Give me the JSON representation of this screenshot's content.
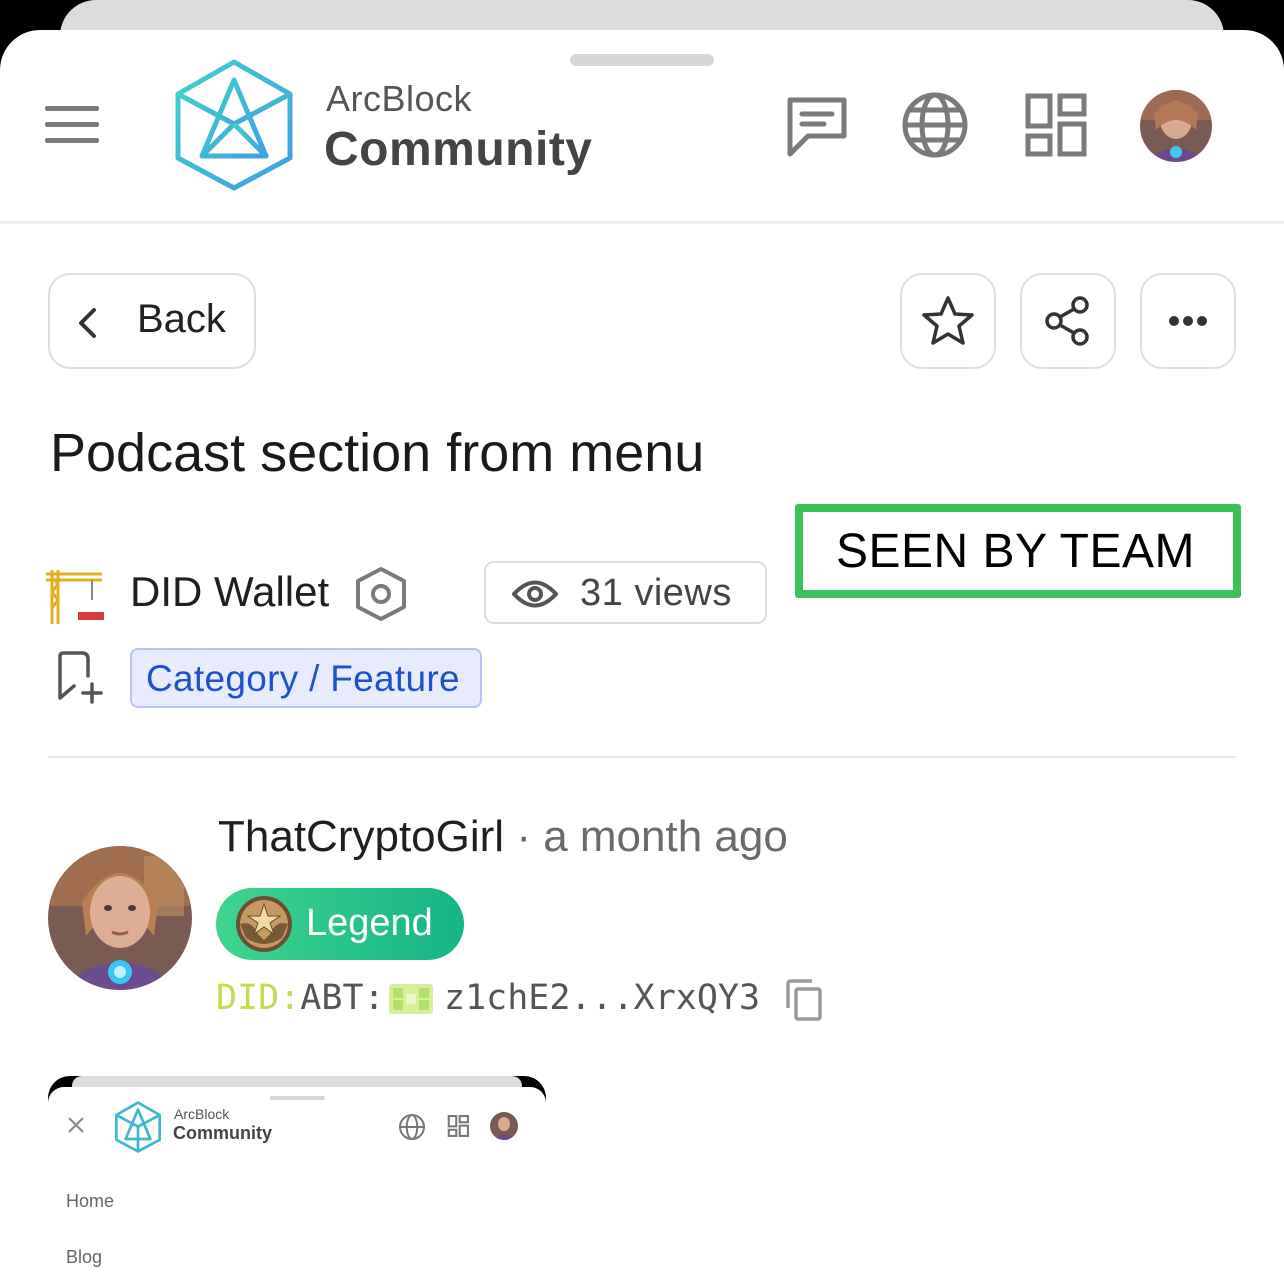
{
  "header": {
    "logo_line1": "ArcBlock",
    "logo_line2": "Community",
    "icons": [
      "hamburger-icon",
      "chat-icon",
      "globe-icon",
      "apps-grid-icon"
    ],
    "accent_color": "#3fc4d8"
  },
  "actions": {
    "back_label": "Back",
    "buttons": [
      "star-icon",
      "share-icon",
      "more-icon"
    ]
  },
  "post": {
    "title": "Podcast section from menu",
    "annotation": "SEEN BY TEAM",
    "board": "DID Wallet",
    "views": "31 views",
    "category": "Category / Feature"
  },
  "author": {
    "name": "ThatCryptoGirl",
    "separator": "·",
    "time": "a month ago",
    "badge": "Legend",
    "did_prefix": "DID:",
    "did_abt": "ABT:",
    "did_value": "z1chE2...XrxQY3"
  },
  "embedded_screenshot": {
    "logo_line1": "ArcBlock",
    "logo_line2": "Community",
    "nav_items": [
      "Home",
      "Blog"
    ]
  },
  "colors": {
    "seen_border": "#3cc05a",
    "category_text": "#1f52c8",
    "badge": "#2ccb8a",
    "did_prefix": "#c8d84f"
  }
}
